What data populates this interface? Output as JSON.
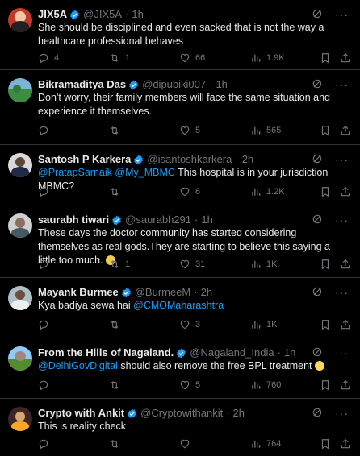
{
  "colors": {
    "background": "#000000",
    "text": "#e7e9ea",
    "secondary": "#71767b",
    "accent": "#1d9bf0",
    "divider": "#2f3336"
  },
  "tweets": [
    {
      "name": "JIX5A",
      "handle": "@JIX5A",
      "time": "1h",
      "text_parts": [
        "She should be disciplined and even sacked that is not the way a healthcare professional behaves"
      ],
      "replies": "4",
      "retweets": "1",
      "likes": "66",
      "views": "1.9K"
    },
    {
      "name": "Bikramaditya Das",
      "handle": "@dipubiki007",
      "time": "1h",
      "text_parts": [
        "Don't worry, their family members will face the same situation and experience it themselves."
      ],
      "replies": "",
      "retweets": "",
      "likes": "5",
      "views": "565"
    },
    {
      "name": "Santosh P Karkera",
      "handle": "@isantoshkarkera",
      "time": "2h",
      "mentions": [
        "@PratapSarnaik",
        "@My_MBMC"
      ],
      "text_parts": [
        "This hospital is in your jurisdiction MBMC?"
      ],
      "replies": "",
      "retweets": "",
      "likes": "6",
      "views": "1.2K"
    },
    {
      "name": "saurabh tiwari",
      "handle": "@saurabh291",
      "time": "1h",
      "text_parts": [
        "These days the doctor community has started considering themselves as real gods.They are starting to believe this saying a little too much."
      ],
      "emoji": "thinking-face",
      "replies": "",
      "retweets": "1",
      "likes": "31",
      "views": "1K"
    },
    {
      "name": "Mayank Burmee",
      "handle": "@BurmeeM",
      "time": "2h",
      "text_parts": [
        "Kya badiya sewa hai"
      ],
      "mentions": [
        "@CMOMaharashtra"
      ],
      "replies": "",
      "retweets": "",
      "likes": "3",
      "views": "1K"
    },
    {
      "name": "From the Hills of Nagaland.",
      "handle": "@Nagaland_India",
      "time": "1h",
      "mentions": [
        "@DelhiGovDigital"
      ],
      "text_parts": [
        "should also remove the free BPL treatment"
      ],
      "emoji": "screaming-face",
      "replies": "",
      "retweets": "",
      "likes": "5",
      "views": "760"
    },
    {
      "name": "Crypto with Ankit",
      "handle": "@Cryptowithankit",
      "time": "2h",
      "text_parts": [
        "This is reality check"
      ],
      "replies": "",
      "retweets": "",
      "likes": "",
      "views": "764"
    }
  ],
  "icons": [
    "reply-icon",
    "retweet-icon",
    "like-icon",
    "views-icon",
    "bookmark-icon",
    "share-icon",
    "grok-icon",
    "more-icon",
    "verified-badge-icon"
  ]
}
